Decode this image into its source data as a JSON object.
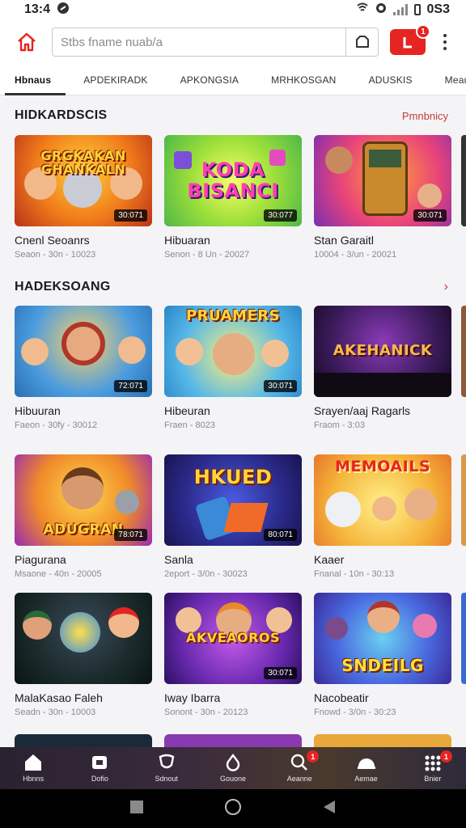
{
  "status": {
    "time": "13:4",
    "right_text": "0S3"
  },
  "search": {
    "placeholder": "Stbs fname nuab/a"
  },
  "notifications": {
    "count": "1"
  },
  "tabs": [
    {
      "label": "Hbnaus",
      "active": true
    },
    {
      "label": "APDEKIRADK",
      "active": false
    },
    {
      "label": "APKONGSIA",
      "active": false
    },
    {
      "label": "MRHKOSGAN",
      "active": false
    },
    {
      "label": "ADUSKIS",
      "active": false
    },
    {
      "label": "Meauss",
      "active": false
    }
  ],
  "section1": {
    "title": "HIDKARDSCIS",
    "more": "Pmnbnicy",
    "cards": [
      {
        "logo": "GRGKAKAN GHANKALN",
        "duration": "30:071",
        "title": "Cnenl Seoanrs",
        "meta": "Seaon - 30n - 10023"
      },
      {
        "logo": "KODA BISANCI",
        "duration": "30:077",
        "title": "Hibuaran",
        "meta": "Senon - 8 Un - 20027"
      },
      {
        "logo": "",
        "duration": "30:071",
        "title": "Stan Garaitl",
        "meta": "10004 - 3/un - 20021"
      }
    ]
  },
  "section2": {
    "title": "HADEKSOANG",
    "rows": [
      [
        {
          "logo": "",
          "duration": "72:071",
          "title": "Hibuuran",
          "meta": "Faeon - 30fy - 30012"
        },
        {
          "logo": "PRUAMERS",
          "duration": "30:071",
          "title": "Hibeuran",
          "meta": "Fraen - 8023"
        },
        {
          "logo": "AKEHANICK",
          "duration": "",
          "title": "Srayen/aaj Ragarls",
          "meta": "Fraom - 3:03"
        }
      ],
      [
        {
          "logo": "ADUGRAN",
          "duration": "78:071",
          "title": "Piagurana",
          "meta": "Msaone - 40n - 20005"
        },
        {
          "logo": "HKUED",
          "duration": "80:071",
          "title": "Sanla",
          "meta": "2eport - 3/0n - 30023"
        },
        {
          "logo": "MEMOAILS",
          "duration": "",
          "title": "Kaaer",
          "meta": "Fnanal - 10n - 30:13"
        }
      ],
      [
        {
          "logo": "",
          "duration": "",
          "title": "MalaKasao Faleh",
          "meta": "Seadn - 30n - 10003"
        },
        {
          "logo": "AKVEAOROS",
          "duration": "30:071",
          "title": "Iway Ibarra",
          "meta": "Sonont - 30n - 20123"
        },
        {
          "logo": "SNDEILG",
          "duration": "",
          "title": "Nacobeatir",
          "meta": "Fnowd - 3/0n - 30:23"
        }
      ]
    ]
  },
  "bottomnav": [
    {
      "label": "Hbnns",
      "icon": "home-icon",
      "badge": ""
    },
    {
      "label": "Dofio",
      "icon": "library-icon",
      "badge": ""
    },
    {
      "label": "Sdnout",
      "icon": "shield-icon",
      "badge": ""
    },
    {
      "label": "Gouone",
      "icon": "drop-icon",
      "badge": ""
    },
    {
      "label": "Aeanne",
      "icon": "chat-search-icon",
      "badge": "1"
    },
    {
      "label": "Aemae",
      "icon": "helmet-icon",
      "badge": ""
    },
    {
      "label": "Bnier",
      "icon": "grid-icon",
      "badge": "1"
    }
  ],
  "colors": {
    "accent": "#e52521",
    "more_link": "#c43b3b"
  }
}
